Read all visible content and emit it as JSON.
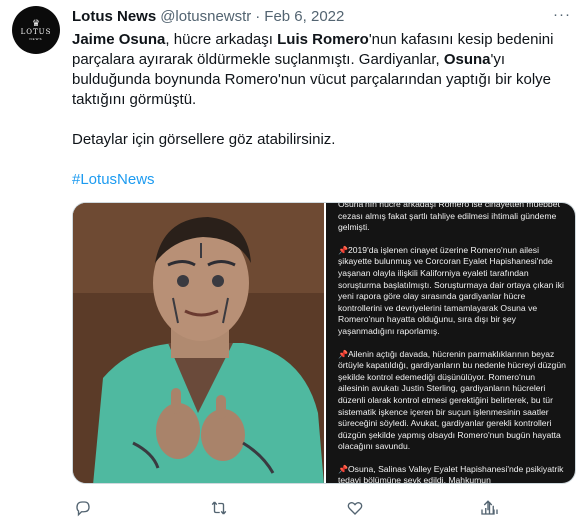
{
  "account": {
    "avatar_text": "LOTUS",
    "avatar_sub": "NEWS",
    "display_name": "Lotus News",
    "handle": "@lotusnewstr",
    "separator": "·",
    "date": "Feb 6, 2022"
  },
  "tweet": {
    "p1_name1": "Jaime Osuna",
    "p1_text1": ", hücre arkadaşı ",
    "p1_name2": "Luis Romero",
    "p1_text2": "'nun kafasını kesip bedenini parçalara ayırarak öldürmekle suçlanmıştı. Gardiyanlar, ",
    "p1_name3": "Osuna",
    "p1_text3": "'yı bulduğunda boynunda Romero'nun vücut parçalarından yaptığı bir kolye taktığını görmüştü.",
    "p2": "Detaylar için görsellere göz atabilirsiniz.",
    "hashtag": "#LotusNews"
  },
  "media": {
    "photo_caption": "",
    "card_paragraphs": [
      "Osuna'nın hücre arkadaşı Romero ise cinayetten müebbet cezası almış fakat şartlı tahliye edilmesi ihtimali gündeme gelmişti.",
      "2019'da işlenen cinayet üzerine Romero'nun ailesi şikayette bulunmuş ve Corcoran Eyalet Hapishanesi'nde yaşanan olayla ilişkili Kaliforniya eyaleti tarafından soruşturma başlatılmıştı. Soruşturmaya dair ortaya çıkan iki yeni rapora göre olay sırasında gardiyanlar hücre kontrollerini ve devriyelerini tamamlayarak Osuna ve Romero'nun hayatta olduğunu, sıra dışı bir şey yaşanmadığını raporlamış.",
      "Ailenin açtığı davada, hücrenin parmaklıklarının beyaz örtüyle kapatıldığı, gardiyanların bu nedenle hücreyi düzgün şekilde kontrol edemediği düşünülüyor. Romero'nun ailesinin avukatı Justin Sterling, gardiyanların hücreleri düzenli olarak kontrol etmesi gerektiğini belirterek, bu tür sistematik işkence içeren bir suçun işlenmesinin saatler süreceğini söyledi. Avukat, gardiyanlar gerekli kontrolleri düzgün şekilde yapmış olsaydı Romero'nun bugün hayatta olacağını savundu.",
      "Osuna, Salinas Valley Eyalet Hapishanesi'nde psikiyatrik tedavi bölümüne sevk edildi. Mahkumun"
    ],
    "pin_icon": "pushpin-icon"
  },
  "actions": {
    "icons": [
      "reply-icon",
      "retweet-icon",
      "like-icon",
      "views-icon",
      "share-icon"
    ]
  },
  "colors": {
    "accent": "#1d9bf0",
    "muted": "#536471",
    "text": "#0f1419",
    "card_bg": "#141414",
    "pin": "#e0463f"
  }
}
